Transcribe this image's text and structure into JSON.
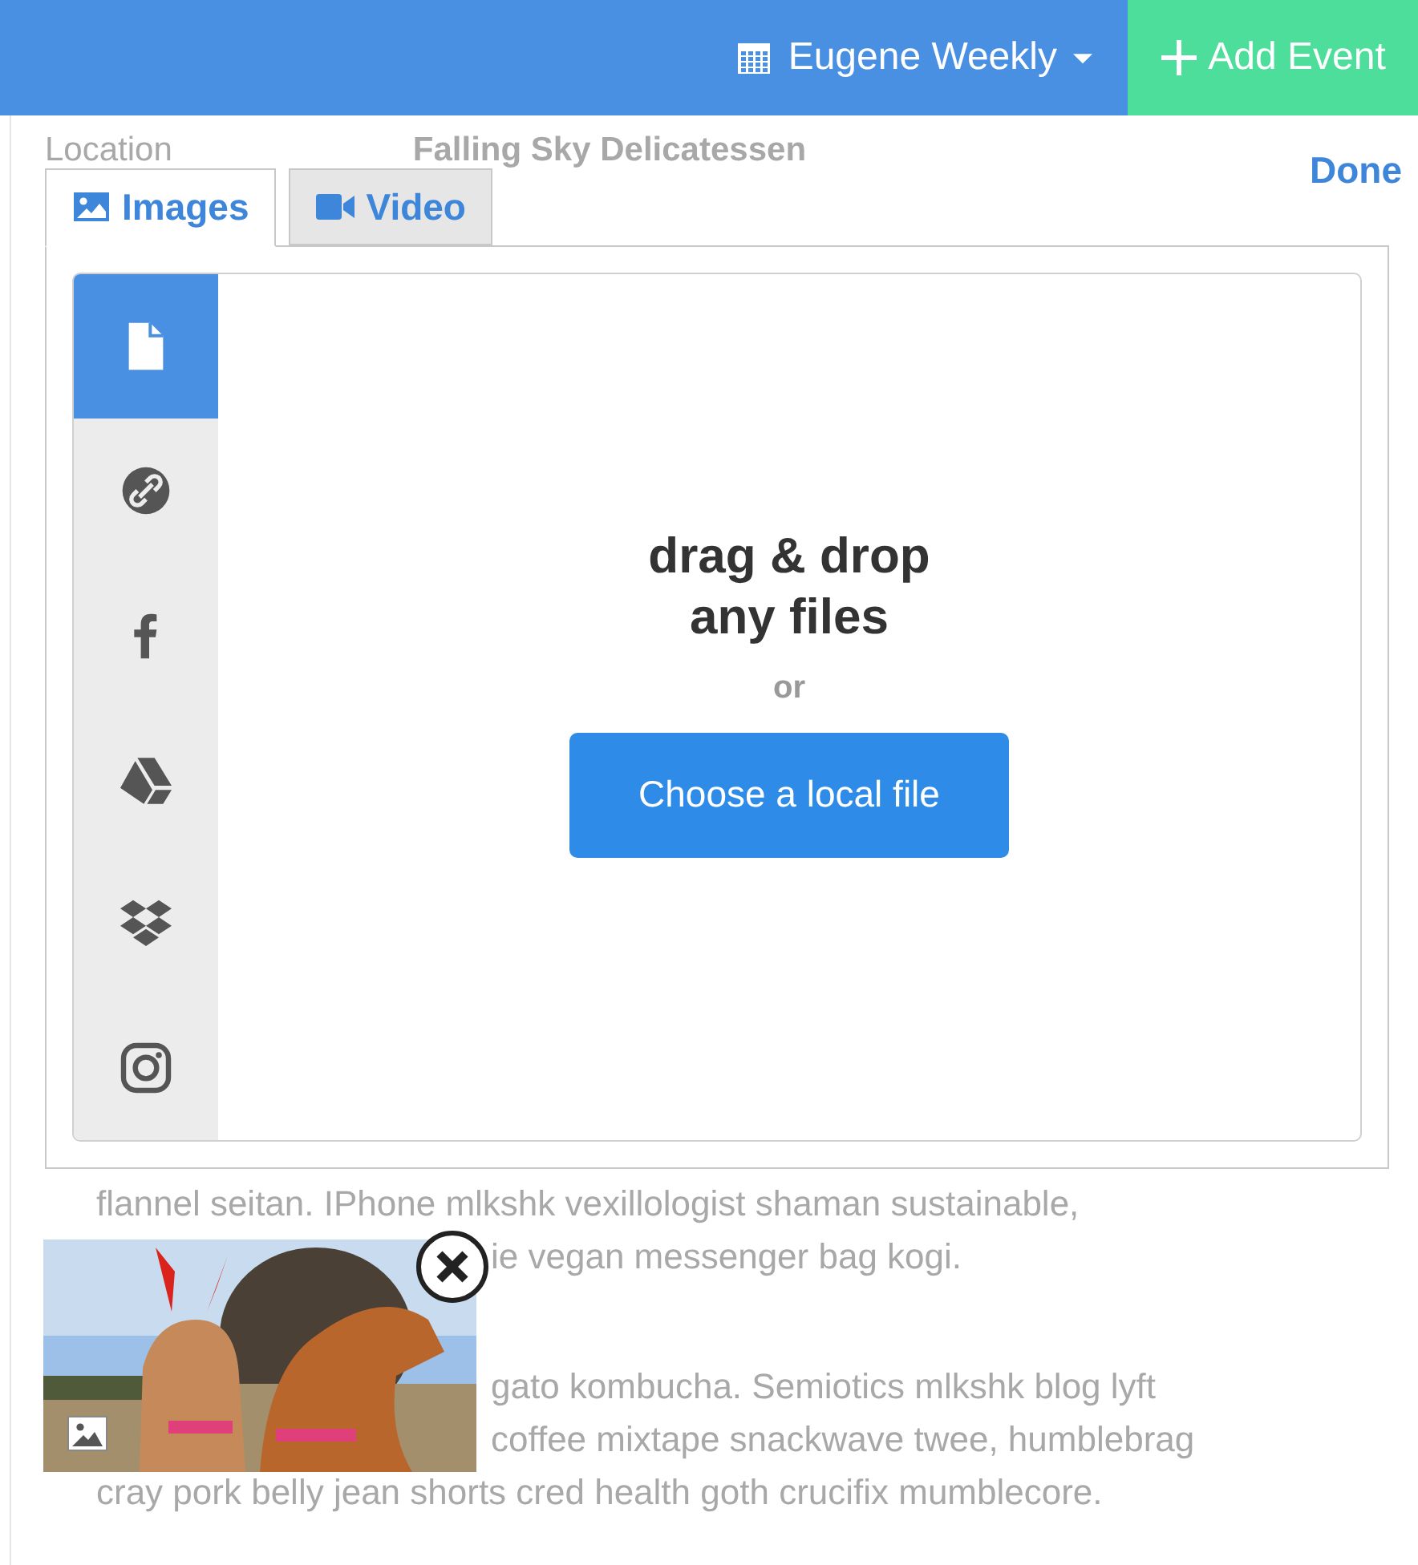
{
  "header": {
    "calendar_label": "Eugene Weekly",
    "add_button": "Add Event"
  },
  "background": {
    "location_label": "Location",
    "venue": "Falling Sky Delicatessen",
    "paragraphs": [
      {
        "lines": [
          {
            "text": "flannel seitan. IPhone mlkshk vexillologist shaman sustainable,",
            "kind": "full"
          },
          {
            "text": "ie vegan messenger bag kogi.",
            "kind": "partial"
          }
        ]
      },
      {
        "lines": [
          {
            "text": "gato kombucha. Semiotics mlkshk blog lyft",
            "kind": "partial"
          },
          {
            "text": "coffee mixtape snackwave twee, humblebrag",
            "kind": "partial"
          },
          {
            "text": "cray pork belly jean shorts cred health goth crucifix mumblecore.",
            "kind": "full"
          }
        ]
      }
    ]
  },
  "modal": {
    "done": "Done",
    "tabs": [
      {
        "label": "Images",
        "kind": "images",
        "selected": true
      },
      {
        "label": "Video",
        "kind": "video",
        "selected": false
      }
    ],
    "sources": [
      {
        "kind": "file",
        "selected": true
      },
      {
        "kind": "link",
        "selected": false
      },
      {
        "kind": "facebook",
        "selected": false
      },
      {
        "kind": "drive",
        "selected": false
      },
      {
        "kind": "dropbox",
        "selected": false
      },
      {
        "kind": "instagram",
        "selected": false
      }
    ],
    "drop": {
      "title_lines": [
        "drag & drop",
        "any files"
      ],
      "or": "or",
      "button": "Choose a local file"
    }
  }
}
